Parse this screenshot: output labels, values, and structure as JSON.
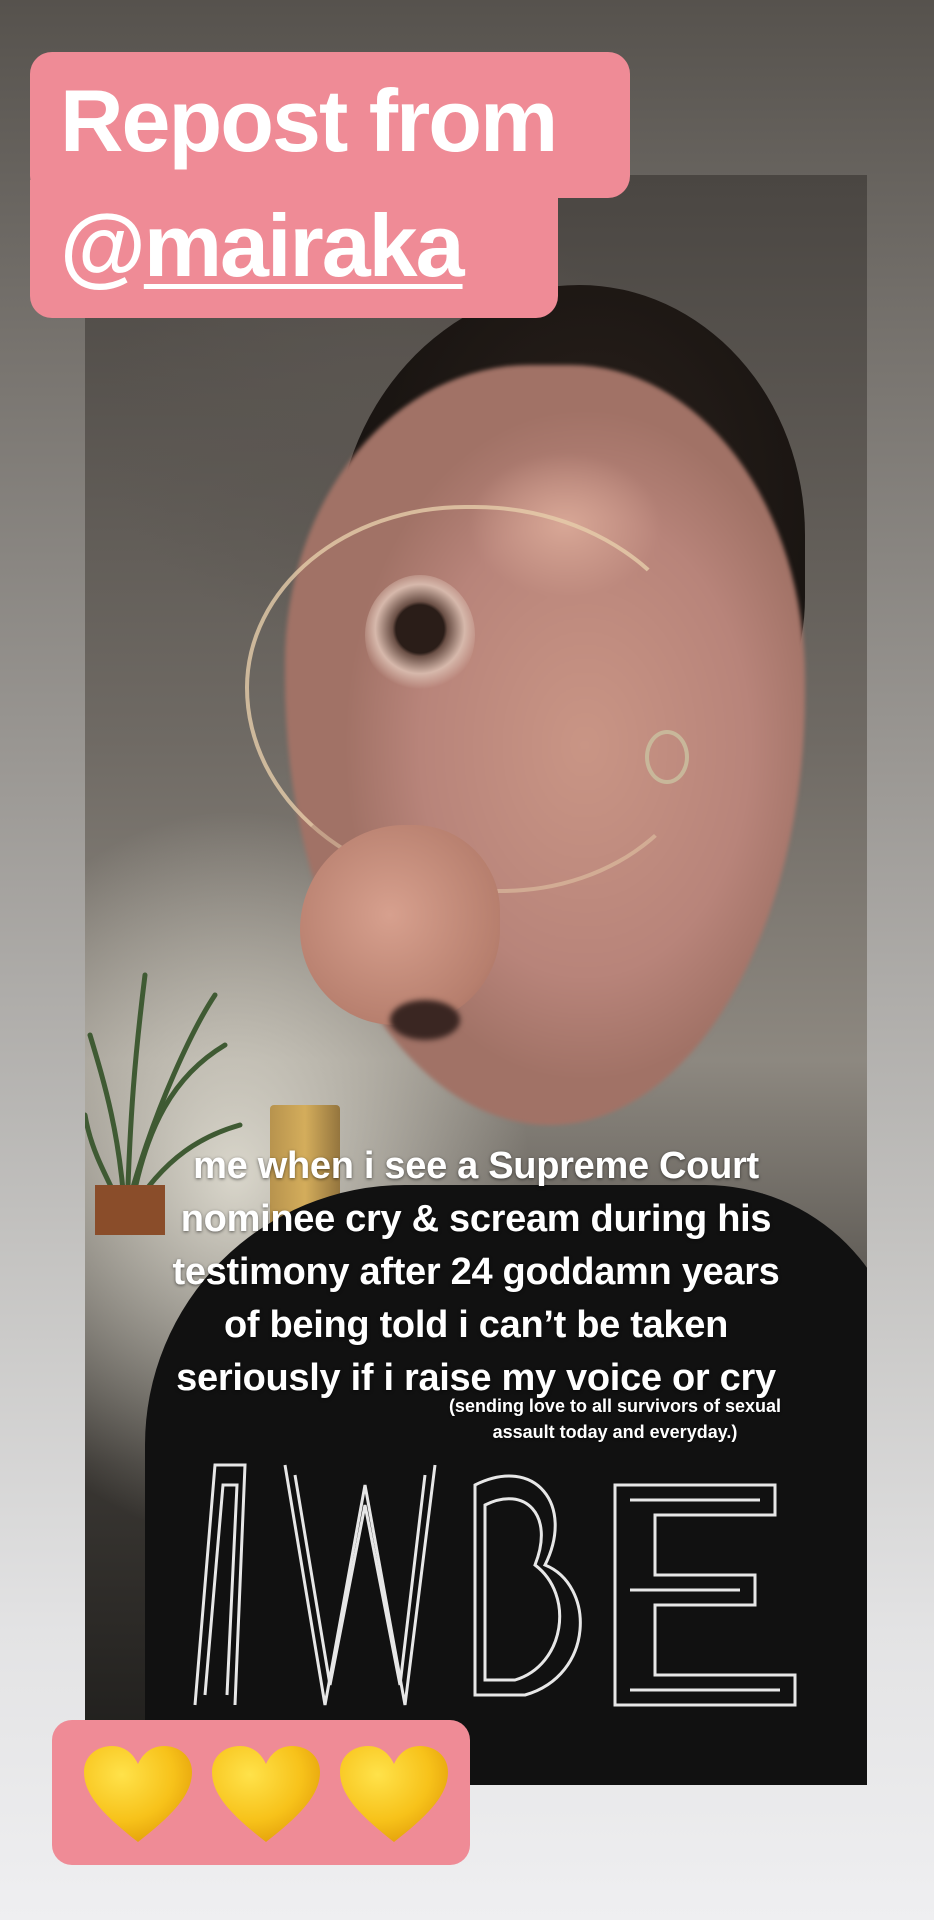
{
  "repost": {
    "prefix": "Repost from",
    "at": "@",
    "handle": "mairaka"
  },
  "caption": {
    "lines": [
      "me when i see a Supreme Court",
      "nominee cry & scream during his",
      "testimony after 24 goddamn years",
      "of being told i can’t be taken",
      "seriously if i raise my voice or cry"
    ]
  },
  "subcaption": {
    "lines": [
      "(sending love to all survivors of sexual",
      "assault today and everyday.)"
    ]
  },
  "stickers": {
    "hearts": [
      "yellow-heart",
      "yellow-heart",
      "yellow-heart"
    ],
    "heart_color": "#f7c21a",
    "box_color": "#ef8b96"
  }
}
